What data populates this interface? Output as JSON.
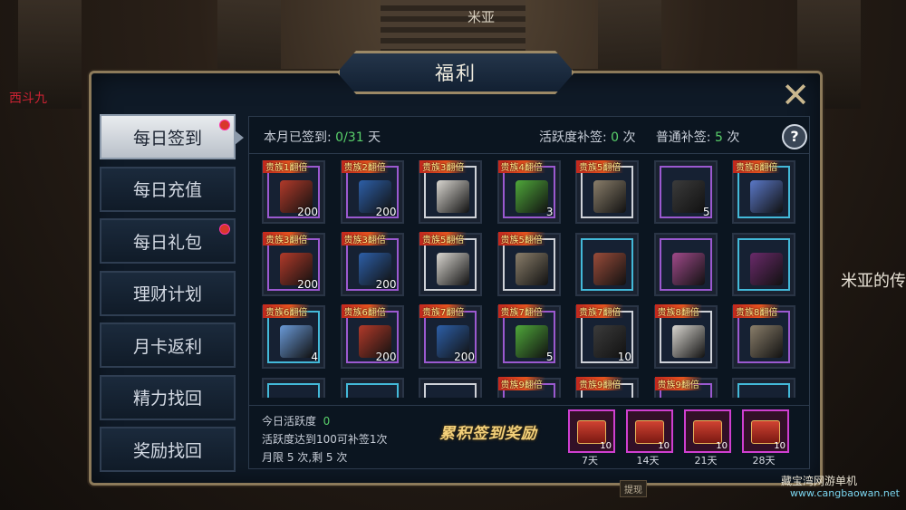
{
  "background": {
    "top_label": "米亚",
    "right_label": "米亚的传",
    "left_label": "西斗九"
  },
  "panel": {
    "title": "福利",
    "close_icon": "close-x-icon"
  },
  "sidebar": {
    "items": [
      {
        "label": "每日签到",
        "active": true,
        "badge": true
      },
      {
        "label": "每日充值",
        "active": false,
        "badge": false
      },
      {
        "label": "每日礼包",
        "active": false,
        "badge": true
      },
      {
        "label": "理财计划",
        "active": false,
        "badge": false
      },
      {
        "label": "月卡返利",
        "active": false,
        "badge": false
      },
      {
        "label": "精力找回",
        "active": false,
        "badge": false
      },
      {
        "label": "奖励找回",
        "active": false,
        "badge": false
      }
    ]
  },
  "info": {
    "signed_label": "本月已签到:",
    "signed_value": "0/31",
    "signed_unit": "天",
    "activity_label": "活跃度补签:",
    "activity_value": "0",
    "activity_unit": "次",
    "normal_label": "普通补签:",
    "normal_value": "5",
    "normal_unit": "次",
    "help_icon": "?"
  },
  "grid": {
    "rows": [
      [
        {
          "tag": "贵族1翻倍",
          "frame": "purple",
          "qty": "200",
          "color": "#b23a2a"
        },
        {
          "tag": "贵族2翻倍",
          "frame": "purple",
          "qty": "200",
          "color": "#2d5fa8"
        },
        {
          "tag": "贵族3翻倍",
          "frame": "white",
          "qty": "",
          "color": "#d9d6d0"
        },
        {
          "tag": "贵族4翻倍",
          "frame": "purple",
          "qty": "3",
          "color": "#4fa83a"
        },
        {
          "tag": "贵族5翻倍",
          "frame": "white",
          "qty": "",
          "color": "#8a7e6a"
        },
        {
          "tag": "",
          "frame": "purple",
          "qty": "5",
          "color": "#3b3b3b"
        },
        {
          "tag": "贵族8翻倍",
          "frame": "blue",
          "qty": "",
          "color": "#5a78c8"
        }
      ],
      [
        {
          "tag": "贵族3翻倍",
          "frame": "purple",
          "qty": "200",
          "color": "#b23a2a"
        },
        {
          "tag": "贵族3翻倍",
          "frame": "purple",
          "qty": "200",
          "color": "#2d5fa8"
        },
        {
          "tag": "贵族5翻倍",
          "frame": "white",
          "qty": "",
          "color": "#d9d6d0"
        },
        {
          "tag": "贵族5翻倍",
          "frame": "white",
          "qty": "",
          "color": "#8a7e6a"
        },
        {
          "tag": "",
          "frame": "blue",
          "qty": "",
          "color": "#9a4c3a"
        },
        {
          "tag": "",
          "frame": "purple",
          "qty": "",
          "color": "#a04a8a"
        },
        {
          "tag": "",
          "frame": "blue",
          "qty": "",
          "color": "#6a2a6a"
        }
      ],
      [
        {
          "tag": "贵族6翻倍",
          "frame": "blue",
          "qty": "4",
          "color": "#6a9ad8"
        },
        {
          "tag": "贵族6翻倍",
          "frame": "purple",
          "qty": "200",
          "color": "#b23a2a"
        },
        {
          "tag": "贵族7翻倍",
          "frame": "purple",
          "qty": "200",
          "color": "#2d5fa8"
        },
        {
          "tag": "贵族7翻倍",
          "frame": "purple",
          "qty": "5",
          "color": "#4fa83a"
        },
        {
          "tag": "贵族7翻倍",
          "frame": "white",
          "qty": "10",
          "color": "#3b3b3b"
        },
        {
          "tag": "贵族8翻倍",
          "frame": "white",
          "qty": "",
          "color": "#d9d6d0"
        },
        {
          "tag": "贵族8翻倍",
          "frame": "purple",
          "qty": "",
          "color": "#8a7e6a"
        }
      ],
      [
        {
          "tag": "",
          "frame": "blue",
          "qty": "",
          "color": "#5a78c8"
        },
        {
          "tag": "",
          "frame": "blue",
          "qty": "",
          "color": "#3a6a8a"
        },
        {
          "tag": "",
          "frame": "white",
          "qty": "",
          "color": "#6a6a6a"
        },
        {
          "tag": "贵族9翻倍",
          "frame": "purple",
          "qty": "",
          "color": "#b23a2a"
        },
        {
          "tag": "贵族9翻倍",
          "frame": "white",
          "qty": "",
          "color": "#8a7e6a"
        },
        {
          "tag": "贵族9翻倍",
          "frame": "purple",
          "qty": "",
          "color": "#a04a8a"
        },
        {
          "tag": "",
          "frame": "blue",
          "qty": "",
          "color": "#5a78c8"
        }
      ]
    ]
  },
  "bottom": {
    "today_label": "今日活跃度",
    "today_value": "0",
    "rule": "活跃度达到100可补签1次",
    "limit": "月限 5 次,剩 5 次",
    "cumulative_title": "累积签到奖励",
    "chests": [
      {
        "qty": "10",
        "days": "7天"
      },
      {
        "qty": "10",
        "days": "14天"
      },
      {
        "qty": "10",
        "days": "21天"
      },
      {
        "qty": "10",
        "days": "28天"
      }
    ]
  },
  "watermark": {
    "line1": "藏宝湾网游单机",
    "line2": "www.cangbaowan.net"
  },
  "bottom_button": "提现"
}
